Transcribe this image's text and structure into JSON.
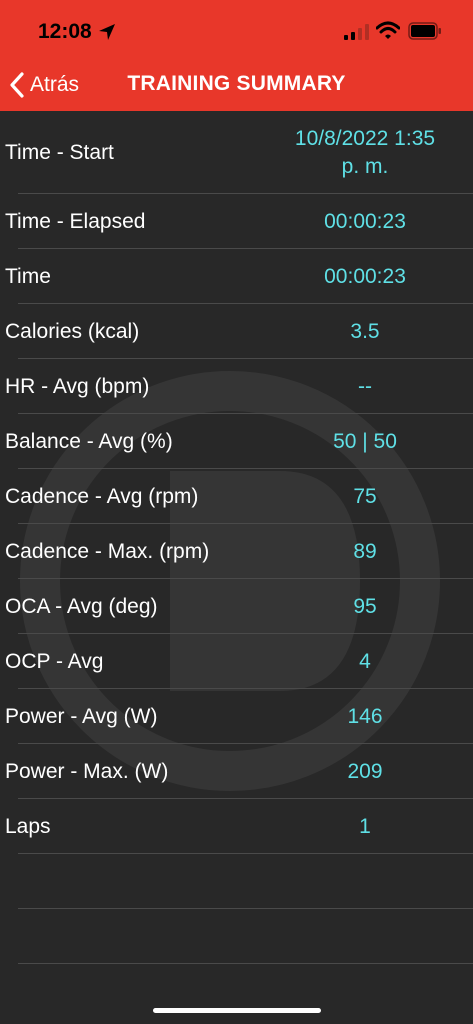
{
  "status": {
    "time": "12:08"
  },
  "nav": {
    "back_label": "Atrás",
    "title": "TRAINING SUMMARY"
  },
  "rows": [
    {
      "label": "Time - Start",
      "value": "10/8/2022 1:35\np. m."
    },
    {
      "label": "Time - Elapsed",
      "value": "00:00:23"
    },
    {
      "label": "Time",
      "value": "00:00:23"
    },
    {
      "label": "Calories (kcal)",
      "value": "3.5"
    },
    {
      "label": "HR - Avg (bpm)",
      "value": "--"
    },
    {
      "label": "Balance - Avg (%)",
      "value": "50 | 50"
    },
    {
      "label": "Cadence - Avg (rpm)",
      "value": "75"
    },
    {
      "label": "Cadence - Max. (rpm)",
      "value": "89"
    },
    {
      "label": "OCA - Avg (deg)",
      "value": "95"
    },
    {
      "label": "OCP - Avg",
      "value": "4"
    },
    {
      "label": "Power - Avg (W)",
      "value": "146"
    },
    {
      "label": "Power - Max. (W)",
      "value": "209"
    },
    {
      "label": "Laps",
      "value": "1"
    }
  ],
  "colors": {
    "header": "#e8372a",
    "background": "#282828",
    "value": "#5fe0e6"
  },
  "icons": [
    "location-arrow-icon",
    "cellular-signal-icon",
    "wifi-icon",
    "battery-icon",
    "chevron-left-icon"
  ]
}
